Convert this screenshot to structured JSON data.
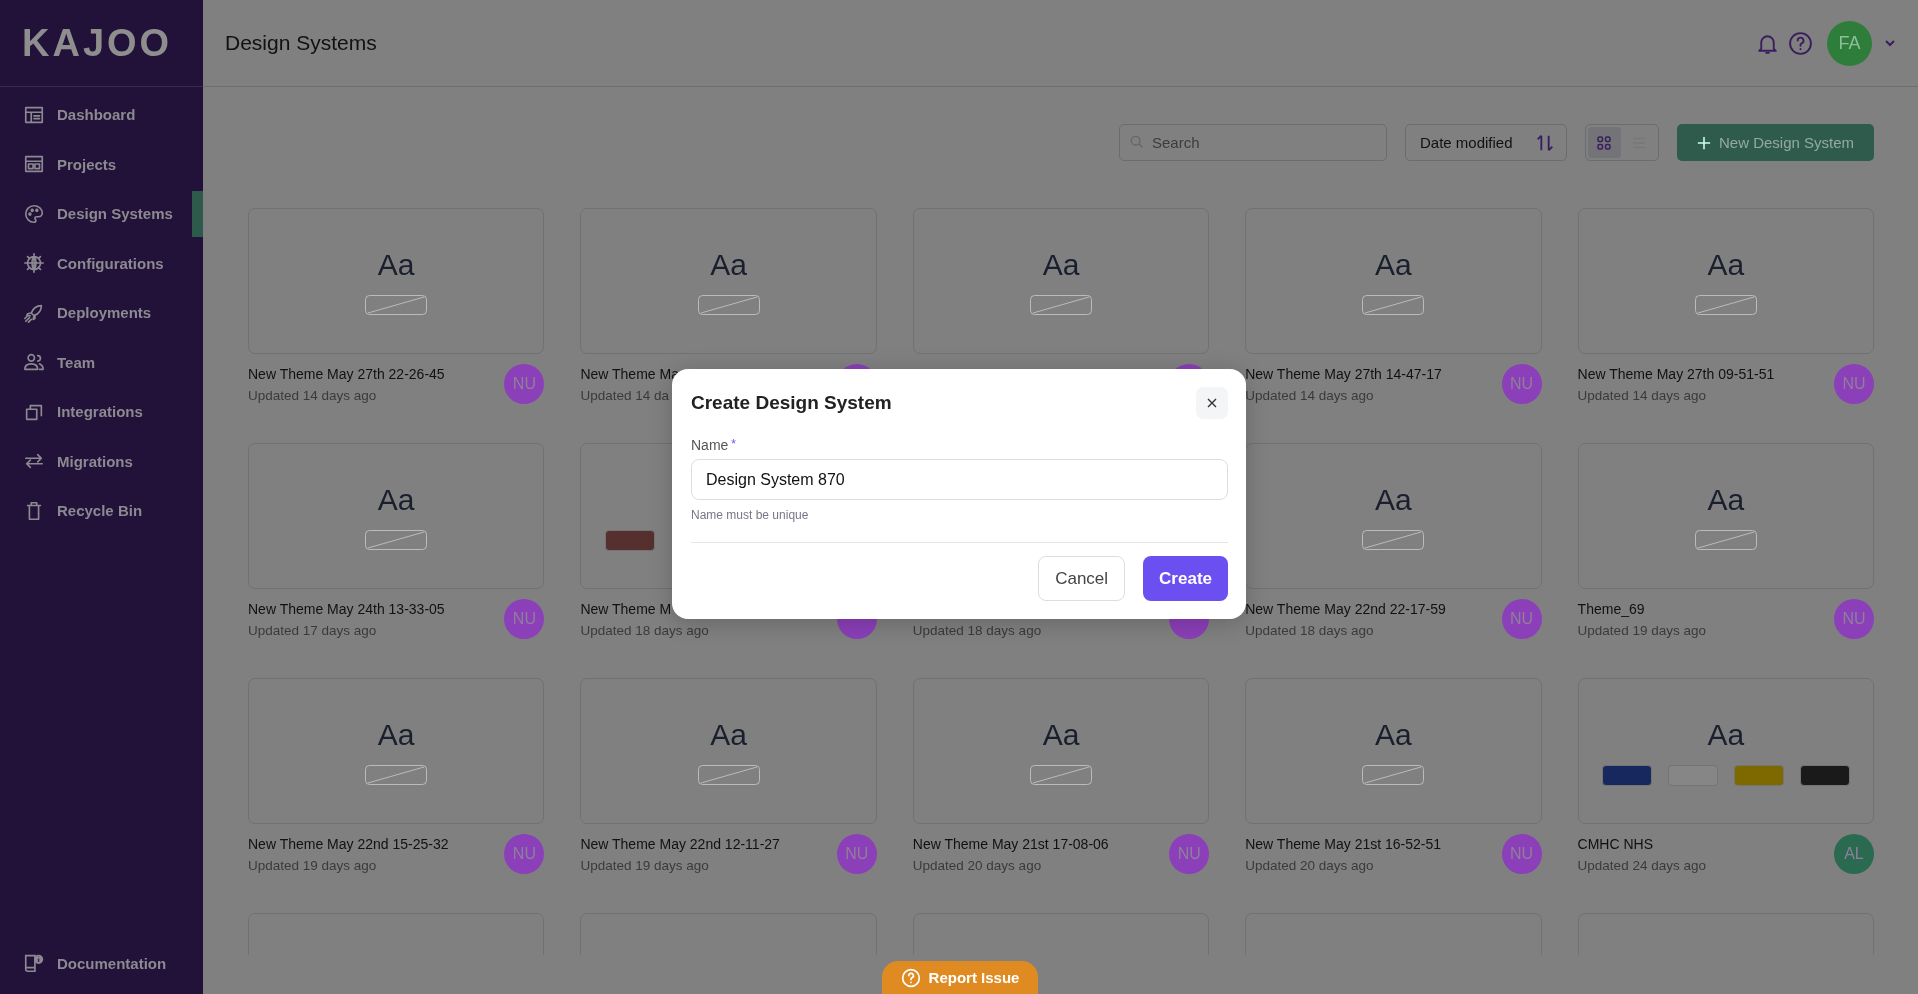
{
  "sidebar": {
    "logo": "KAJOO",
    "items": [
      {
        "label": "Dashboard",
        "selected": false
      },
      {
        "label": "Projects",
        "selected": false
      },
      {
        "label": "Design Systems",
        "selected": true
      },
      {
        "label": "Configurations",
        "selected": false
      },
      {
        "label": "Deployments",
        "selected": false
      },
      {
        "label": "Team",
        "selected": false
      },
      {
        "label": "Integrations",
        "selected": false
      },
      {
        "label": "Migrations",
        "selected": false
      },
      {
        "label": "Recycle Bin",
        "selected": false
      }
    ],
    "footer_item": {
      "label": "Documentation"
    }
  },
  "header": {
    "title": "Design Systems",
    "user": {
      "initials": "FA"
    }
  },
  "toolbar": {
    "search": {
      "placeholder": "Search"
    },
    "sort": {
      "label": "Date modified"
    },
    "view_modes": [
      {
        "selected": true
      },
      {
        "selected": false
      }
    ],
    "new_button": {
      "label": "New Design System"
    }
  },
  "cards": [
    {
      "kind": "card",
      "preview": "Aa",
      "name": "New Theme May 27th 22-26-45",
      "updated": "Updated 14 days ago",
      "avatar": {
        "initials": "NU",
        "color": "#8b3fb8"
      }
    },
    {
      "kind": "card",
      "preview": "Aa",
      "name": "New Theme Ma",
      "updated": "Updated 14 da",
      "avatar": {
        "color": "#8b3fb8"
      }
    },
    {
      "kind": "card",
      "preview": "Aa",
      "avatar": {
        "color": "#8b3fb8"
      }
    },
    {
      "kind": "card",
      "preview": "Aa",
      "name": "New Theme May 27th 14-47-17",
      "updated": "Updated 14 days ago",
      "avatar": {
        "initials": "NU",
        "color": "#8b3fb8"
      }
    },
    {
      "kind": "card",
      "preview": "Aa",
      "name": "New Theme May 27th 09-51-51",
      "updated": "Updated 14 days ago",
      "avatar": {
        "initials": "NU",
        "color": "#8b3fb8"
      }
    },
    {
      "kind": "card",
      "preview": "Aa",
      "name": "New Theme May 24th 13-33-05",
      "updated": "Updated 17 days ago",
      "avatar": {
        "initials": "NU",
        "color": "#8b3fb8"
      }
    },
    {
      "kind": "card",
      "swatches": [
        {
          "color": "#55302f"
        }
      ],
      "name": "New Theme M",
      "updated": "Updated 18 days ago",
      "avatar": {
        "color": "#8b3fb8"
      }
    },
    {
      "kind": "covered",
      "updated": "Updated 18 days ago",
      "avatar": {
        "color": "#8b3fb8"
      }
    },
    {
      "kind": "card",
      "preview": "Aa",
      "name": "New Theme May 22nd 22-17-59",
      "updated": "Updated 18 days ago",
      "avatar": {
        "initials": "NU",
        "color": "#8b3fb8"
      }
    },
    {
      "kind": "card",
      "preview": "Aa",
      "name": "Theme_69",
      "updated": "Updated 19 days ago",
      "avatar": {
        "initials": "NU",
        "color": "#8b3fb8"
      }
    },
    {
      "kind": "card",
      "preview": "Aa",
      "name": "New Theme May 22nd 15-25-32",
      "updated": "Updated 19 days ago",
      "avatar": {
        "initials": "NU",
        "color": "#8b3fb8"
      }
    },
    {
      "kind": "card",
      "preview": "Aa",
      "name": "New Theme May 22nd 12-11-27",
      "updated": "Updated 19 days ago",
      "avatar": {
        "initials": "NU",
        "color": "#8b3fb8"
      }
    },
    {
      "kind": "card",
      "preview": "Aa",
      "name": "New Theme May 21st 17-08-06",
      "updated": "Updated 20 days ago",
      "avatar": {
        "initials": "NU",
        "color": "#8b3fb8"
      }
    },
    {
      "kind": "card",
      "preview": "Aa",
      "name": "New Theme May 21st 16-52-51",
      "updated": "Updated 20 days ago",
      "avatar": {
        "initials": "NU",
        "color": "#8b3fb8"
      }
    },
    {
      "kind": "card",
      "preview": "Aa",
      "swatches": [
        {
          "color": "#16285e"
        },
        {
          "color": "#868686"
        },
        {
          "color": "#7d6900"
        },
        {
          "color": "#1a1a1a"
        }
      ],
      "name": "CMHC NHS",
      "updated": "Updated 24 days ago",
      "avatar": {
        "initials": "AL",
        "color": "#2a6a50"
      }
    },
    {
      "kind": "clipped"
    },
    {
      "kind": "clipped"
    },
    {
      "kind": "clipped"
    },
    {
      "kind": "clipped"
    },
    {
      "kind": "clipped"
    }
  ],
  "modal": {
    "title": "Create Design System",
    "field": {
      "label": "Name",
      "required_mark": "*",
      "value": "Design System 870",
      "hint": "Name must be unique"
    },
    "buttons": [
      {
        "label": "Cancel",
        "kind": "secondary"
      },
      {
        "label": "Create",
        "kind": "primary"
      }
    ]
  },
  "report_button": {
    "label": "Report Issue"
  }
}
